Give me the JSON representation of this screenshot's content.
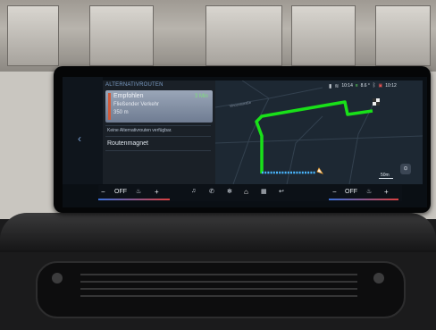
{
  "sidebar": {
    "title": "ALTERNATIVROUTEN",
    "recommended": {
      "title": "Empfohlen",
      "subtitle": "Fließender Verkehr",
      "distance": "350 m",
      "time": "3 Min"
    },
    "info": "Keine Alternativrouten verfügbar.",
    "magnet": "Routenmagnet"
  },
  "status": {
    "time_left": "10:14",
    "temp": "8.6 °",
    "time_right": "10:12"
  },
  "map": {
    "scale": "50m",
    "compass": "⊙",
    "street_labels": [
      "Vincentstraße"
    ]
  },
  "bottom": {
    "left": {
      "minus": "−",
      "state": "OFF",
      "plus": "+"
    },
    "right": {
      "minus": "−",
      "state": "OFF",
      "plus": "+"
    },
    "icons": [
      "music-icon",
      "phone-icon",
      "fan-icon",
      "home-icon",
      "apps-icon",
      "back-icon"
    ]
  },
  "colors": {
    "route": "#19e019",
    "traffic": "#4ab7ff",
    "accent": "#7ee07a"
  }
}
